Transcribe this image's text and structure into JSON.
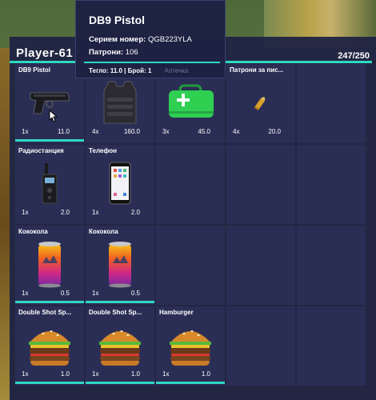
{
  "header": {
    "player_name": "Player-61",
    "weight_text": "247/250",
    "capacity_fraction": 0.988
  },
  "tooltip": {
    "title": "DB9 Pistol",
    "serial_label": "Серием номер:",
    "serial_value": "QGB223YLA",
    "ammo_label": "Патрони:",
    "ammo_value": "106",
    "weight_count_text": "Тегло: 11.0 | Брой: 1",
    "next_slot_label": "Аптечка"
  },
  "slots": [
    {
      "name": "DB9 Pistol",
      "qty": "1x",
      "weight": "11.0",
      "icon": "pistol-icon",
      "durability": true
    },
    {
      "name": "",
      "qty": "4x",
      "weight": "160.0",
      "icon": "body-armor-icon",
      "durability": false
    },
    {
      "name": "Аптечка",
      "qty": "3x",
      "weight": "45.0",
      "icon": "first-aid-kit-icon",
      "durability": false
    },
    {
      "name": "Патрони за пис...",
      "qty": "4x",
      "weight": "20.0",
      "icon": "pistol-ammo-icon",
      "durability": false
    },
    {
      "name": "",
      "qty": "",
      "weight": "",
      "icon": "",
      "durability": false
    },
    {
      "name": "Радиостанция",
      "qty": "1x",
      "weight": "2.0",
      "icon": "radio-icon",
      "durability": false
    },
    {
      "name": "Телефон",
      "qty": "1x",
      "weight": "2.0",
      "icon": "phone-icon",
      "durability": false
    },
    {
      "name": "",
      "qty": "",
      "weight": "",
      "icon": "",
      "durability": false
    },
    {
      "name": "",
      "qty": "",
      "weight": "",
      "icon": "",
      "durability": false
    },
    {
      "name": "",
      "qty": "",
      "weight": "",
      "icon": "",
      "durability": false
    },
    {
      "name": "Кококола",
      "qty": "1x",
      "weight": "0.5",
      "icon": "soda-can-icon",
      "durability": true
    },
    {
      "name": "Кококола",
      "qty": "1x",
      "weight": "0.5",
      "icon": "soda-can-icon",
      "durability": true
    },
    {
      "name": "",
      "qty": "",
      "weight": "",
      "icon": "",
      "durability": false
    },
    {
      "name": "",
      "qty": "",
      "weight": "",
      "icon": "",
      "durability": false
    },
    {
      "name": "",
      "qty": "",
      "weight": "",
      "icon": "",
      "durability": false
    },
    {
      "name": "Double Shot Sp...",
      "qty": "1x",
      "weight": "1.0",
      "icon": "burger-icon",
      "durability": true
    },
    {
      "name": "Double Shot Sp...",
      "qty": "1x",
      "weight": "1.0",
      "icon": "burger-icon",
      "durability": true
    },
    {
      "name": "Hamburger",
      "qty": "1x",
      "weight": "1.0",
      "icon": "burger-icon",
      "durability": true
    },
    {
      "name": "",
      "qty": "",
      "weight": "",
      "icon": "",
      "durability": false
    },
    {
      "name": "",
      "qty": "",
      "weight": "",
      "icon": "",
      "durability": false
    }
  ],
  "colors": {
    "accent": "#2fd8c2",
    "panel": "#20244a",
    "slot": "#2a2e55"
  }
}
